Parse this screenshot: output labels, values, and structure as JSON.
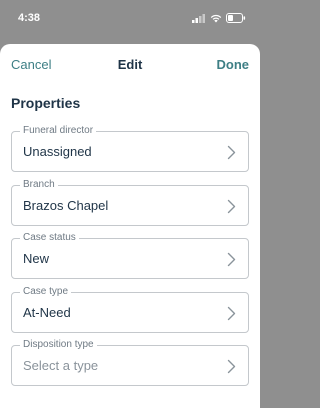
{
  "status_bar": {
    "time": "4:38",
    "icons": [
      "signal-icon",
      "wifi-icon",
      "battery-icon"
    ]
  },
  "nav": {
    "cancel_label": "Cancel",
    "title": "Edit",
    "done_label": "Done"
  },
  "section": {
    "title": "Properties"
  },
  "fields": [
    {
      "label": "Funeral director",
      "value": "Unassigned"
    },
    {
      "label": "Branch",
      "value": "Brazos Chapel"
    },
    {
      "label": "Case status",
      "value": "New"
    },
    {
      "label": "Case type",
      "value": "At-Need"
    },
    {
      "label": "Disposition type",
      "placeholder": "Select a type"
    }
  ],
  "colors": {
    "accent": "#3e7f85",
    "title": "#1f3447",
    "border": "#c4c8cc",
    "backdrop": "#8f8f8f"
  }
}
